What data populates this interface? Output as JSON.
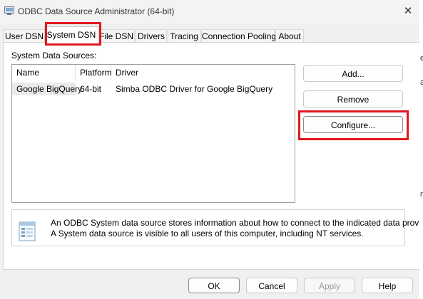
{
  "window": {
    "title": "ODBC Data Source Administrator (64-bit)",
    "close_glyph": "✕"
  },
  "tabs": [
    {
      "label": "User DSN",
      "active": false
    },
    {
      "label": "System DSN",
      "active": true
    },
    {
      "label": "File DSN",
      "active": false
    },
    {
      "label": "Drivers",
      "active": false
    },
    {
      "label": "Tracing",
      "active": false
    },
    {
      "label": "Connection Pooling",
      "active": false
    },
    {
      "label": "About",
      "active": false
    }
  ],
  "system_dsn": {
    "list_label": "System Data Sources:",
    "columns": [
      "Name",
      "Platform",
      "Driver"
    ],
    "rows": [
      {
        "name": "Google BigQuery",
        "platform": "64-bit",
        "driver": "Simba ODBC Driver for Google BigQuery"
      }
    ],
    "buttons": {
      "add": "Add...",
      "remove": "Remove",
      "configure": "Configure..."
    },
    "info_line1": "An ODBC System data source stores information about how to connect to the indicated data provider.",
    "info_line2": "A System data source is visible to all users of this computer, including NT services."
  },
  "footer": {
    "ok": "OK",
    "cancel": "Cancel",
    "apply": "Apply",
    "help": "Help"
  },
  "edge_chars": [
    "e",
    "a",
    "n"
  ],
  "colors": {
    "highlight_box": "#e0181f",
    "window_bg": "#f0f0f0"
  }
}
